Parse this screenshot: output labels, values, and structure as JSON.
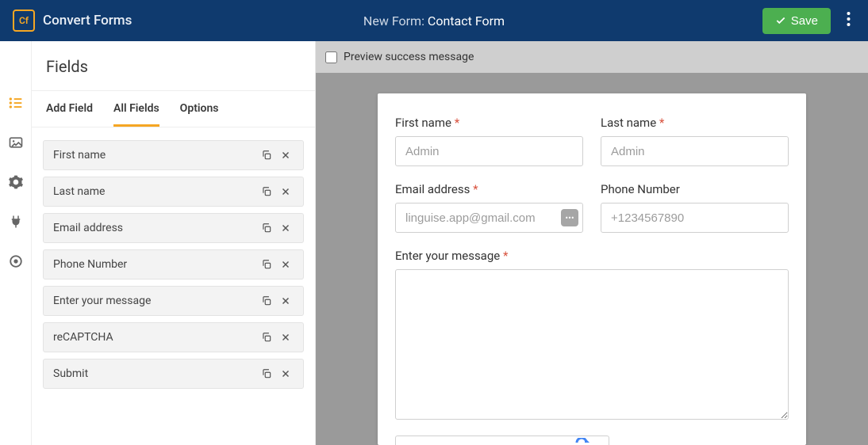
{
  "header": {
    "brand_initials": "Cf",
    "brand_name": "Convert Forms",
    "title_prefix": "New Form:",
    "title_name": "Contact Form",
    "save_label": "Save"
  },
  "sidebar": {
    "title": "Fields",
    "tabs": {
      "add_field": "Add Field",
      "all_fields": "All Fields",
      "options": "Options"
    },
    "fields": [
      {
        "label": "First name"
      },
      {
        "label": "Last name"
      },
      {
        "label": "Email address"
      },
      {
        "label": "Phone Number"
      },
      {
        "label": "Enter your message"
      },
      {
        "label": "reCAPTCHA"
      },
      {
        "label": "Submit"
      }
    ]
  },
  "canvas": {
    "preview_label": "Preview success message",
    "form": {
      "first_name": {
        "label": "First name",
        "placeholder": "Admin"
      },
      "last_name": {
        "label": "Last name",
        "placeholder": "Admin"
      },
      "email": {
        "label": "Email address",
        "placeholder": "linguise.app@gmail.com"
      },
      "phone": {
        "label": "Phone Number",
        "placeholder": "+1234567890"
      },
      "message": {
        "label": "Enter your message"
      }
    }
  }
}
